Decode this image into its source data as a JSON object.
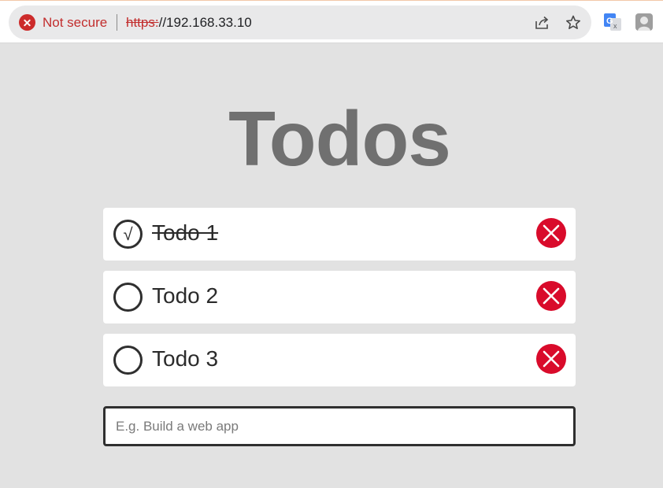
{
  "browser": {
    "security_text": "Not secure",
    "url_scheme": "https:",
    "url_rest": "//192.168.33.10",
    "icons": [
      "share-icon",
      "bookmark-star-icon",
      "google-translate-icon",
      "profile-avatar-icon"
    ]
  },
  "app": {
    "title": "Todos",
    "todos": [
      {
        "label": "Todo 1",
        "done": true,
        "check_glyph": "√"
      },
      {
        "label": "Todo 2",
        "done": false,
        "check_glyph": ""
      },
      {
        "label": "Todo 3",
        "done": false,
        "check_glyph": ""
      }
    ],
    "new_todo": {
      "placeholder": "E.g. Build a web app",
      "value": ""
    }
  },
  "colors": {
    "page_bg": "#e2e2e2",
    "title": "#707070",
    "delete_button": "#d90b2b",
    "not_secure": "#c22d2d"
  }
}
